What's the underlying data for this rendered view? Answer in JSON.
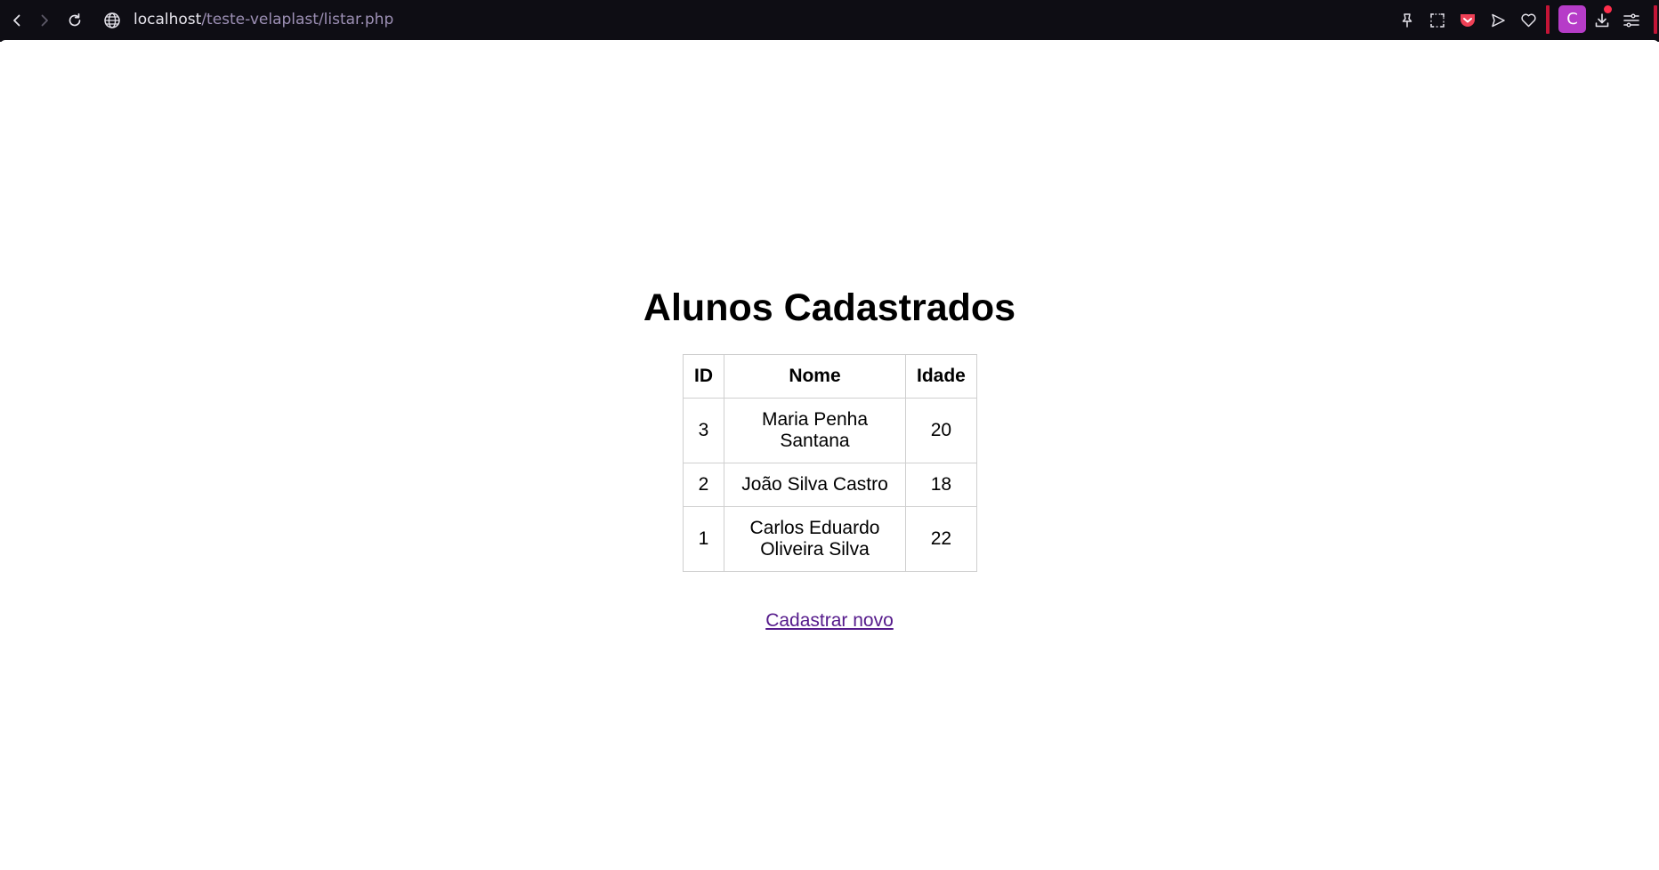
{
  "browser": {
    "url_host": "localhost",
    "url_path": "/teste-velaplast/listar.php",
    "profile_initial": "C",
    "icons": {
      "back": "back-arrow-icon",
      "forward": "forward-arrow-icon",
      "reload": "reload-icon",
      "site_info": "globe-icon",
      "pin": "pin-icon",
      "snapshot": "snapshot-icon",
      "pocket": "pocket-icon",
      "send": "send-icon",
      "favorite": "heart-icon",
      "downloads": "download-icon",
      "menu": "menu-icon"
    },
    "colors": {
      "toolbar_bg": "#0e0d14",
      "accent_red": "#c41436",
      "avatar_bg": "#b63cc8",
      "pocket_red": "#ef4056"
    }
  },
  "page": {
    "title": "Alunos Cadastrados",
    "table": {
      "headers": [
        "ID",
        "Nome",
        "Idade"
      ],
      "rows": [
        {
          "id": "3",
          "nome_line1": "Maria Penha",
          "nome_line2": "Santana",
          "idade": "20"
        },
        {
          "id": "2",
          "nome_line1": "João Silva Castro",
          "nome_line2": "",
          "idade": "18"
        },
        {
          "id": "1",
          "nome_line1": "Carlos Eduardo",
          "nome_line2": "Oliveira Silva",
          "idade": "22"
        }
      ]
    },
    "new_link_label": "Cadastrar novo",
    "link_color": "#551a8b"
  }
}
